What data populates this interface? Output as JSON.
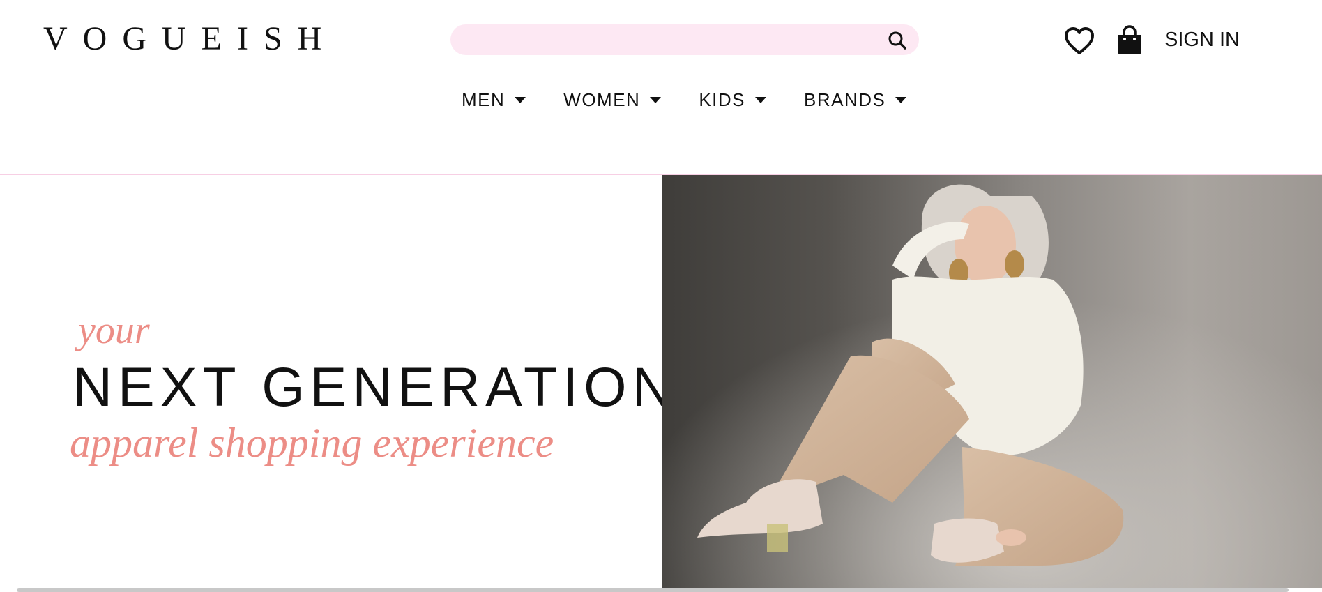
{
  "brand": {
    "logo_text": "VOGUEISH"
  },
  "header": {
    "search": {
      "value": "",
      "placeholder": ""
    },
    "icons": {
      "search": "search-icon",
      "wishlist": "heart-icon",
      "cart": "shopping-bag-icon"
    },
    "sign_in_label": "SIGN IN"
  },
  "nav": {
    "items": [
      {
        "label": "MEN"
      },
      {
        "label": "WOMEN"
      },
      {
        "label": "KIDS"
      },
      {
        "label": "BRANDS"
      }
    ]
  },
  "hero": {
    "tagline_top": "your",
    "headline": "NEXT GENERATION",
    "tagline_bottom": "apparel shopping experience",
    "image_alt": "Model in white knit sweater, beige trousers and cream ankle boots sitting on studio floor"
  },
  "colors": {
    "accent_pink": "#ec8d86",
    "search_bg": "#fde8f3",
    "divider_pink": "#f7cfe4",
    "text_dark": "#111111"
  }
}
